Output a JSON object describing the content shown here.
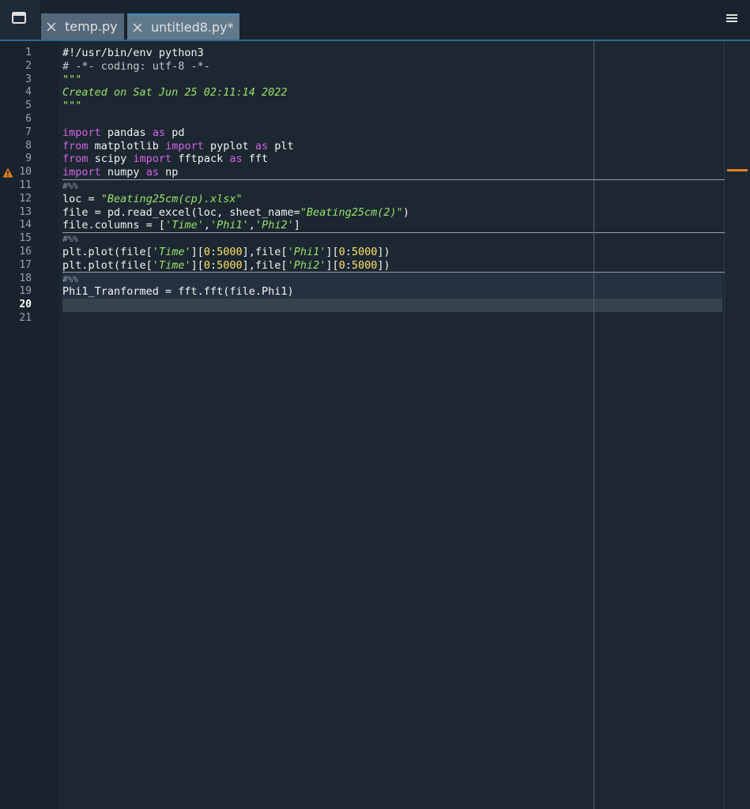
{
  "tabs": [
    {
      "label": "temp.py"
    },
    {
      "label": "untitled8.py*"
    }
  ],
  "icons": {
    "browse": "window-icon",
    "close": "close-icon",
    "menu": "hamburger-menu-icon",
    "warning": "warning-icon"
  },
  "colors": {
    "keyword": "#d664e6",
    "string": "#9be26b",
    "number": "#ffe066",
    "warning": "#e67e22",
    "tab_accent": "#3f88c4"
  },
  "editor": {
    "current_line": 20,
    "warning_line": 10,
    "lines": [
      {
        "n": "1",
        "tokens": [
          [
            "t",
            "#!/usr/bin/env python3"
          ]
        ]
      },
      {
        "n": "2",
        "tokens": [
          [
            "c",
            "# -*- coding: utf-8 -*-"
          ]
        ]
      },
      {
        "n": "3",
        "tokens": [
          [
            "d",
            "\"\"\""
          ]
        ]
      },
      {
        "n": "4",
        "tokens": [
          [
            "d",
            "Created on Sat Jun 25 02:11:14 2022"
          ]
        ]
      },
      {
        "n": "5",
        "tokens": [
          [
            "d",
            "\"\"\""
          ]
        ]
      },
      {
        "n": "6",
        "tokens": []
      },
      {
        "n": "7",
        "tokens": [
          [
            "k",
            "import"
          ],
          [
            "t",
            " pandas "
          ],
          [
            "k",
            "as"
          ],
          [
            "t",
            " pd"
          ]
        ]
      },
      {
        "n": "8",
        "tokens": [
          [
            "k",
            "from"
          ],
          [
            "t",
            " matplotlib "
          ],
          [
            "k",
            "import"
          ],
          [
            "t",
            " pyplot "
          ],
          [
            "k",
            "as"
          ],
          [
            "t",
            " plt"
          ]
        ]
      },
      {
        "n": "9",
        "tokens": [
          [
            "k",
            "from"
          ],
          [
            "t",
            " scipy "
          ],
          [
            "k",
            "import"
          ],
          [
            "t",
            " fftpack "
          ],
          [
            "k",
            "as"
          ],
          [
            "t",
            " fft"
          ]
        ]
      },
      {
        "n": "10",
        "tokens": [
          [
            "k",
            "import"
          ],
          [
            "t",
            " numpy "
          ],
          [
            "k",
            "as"
          ],
          [
            "t",
            " np"
          ]
        ]
      },
      {
        "n": "11",
        "tokens": [
          [
            "cell",
            "#%%"
          ]
        ]
      },
      {
        "n": "12",
        "tokens": [
          [
            "t",
            "loc = "
          ],
          [
            "s",
            "\""
          ],
          [
            "si",
            "Beating25cm(cp).xlsx"
          ],
          [
            "s",
            "\""
          ]
        ]
      },
      {
        "n": "13",
        "tokens": [
          [
            "t",
            "file = pd.read_excel(loc, sheet_name="
          ],
          [
            "s",
            "\""
          ],
          [
            "si",
            "Beating25cm(2)"
          ],
          [
            "s",
            "\""
          ],
          [
            "t",
            ")"
          ]
        ]
      },
      {
        "n": "14",
        "tokens": [
          [
            "t",
            "file.columns = ["
          ],
          [
            "s",
            "'"
          ],
          [
            "si",
            "Time"
          ],
          [
            "s",
            "'"
          ],
          [
            "t",
            ","
          ],
          [
            "s",
            "'"
          ],
          [
            "si",
            "Phi1"
          ],
          [
            "s",
            "'"
          ],
          [
            "t",
            ","
          ],
          [
            "s",
            "'"
          ],
          [
            "si",
            "Phi2"
          ],
          [
            "s",
            "'"
          ],
          [
            "t",
            "]"
          ]
        ]
      },
      {
        "n": "15",
        "tokens": [
          [
            "cell",
            "#%%"
          ]
        ]
      },
      {
        "n": "16",
        "tokens": [
          [
            "t",
            "plt.plot(file["
          ],
          [
            "s",
            "'"
          ],
          [
            "si",
            "Time"
          ],
          [
            "s",
            "'"
          ],
          [
            "t",
            "]["
          ],
          [
            "nm",
            "0"
          ],
          [
            "t",
            ":"
          ],
          [
            "nm",
            "5000"
          ],
          [
            "t",
            "],file["
          ],
          [
            "s",
            "'"
          ],
          [
            "si",
            "Phi1"
          ],
          [
            "s",
            "'"
          ],
          [
            "t",
            "]["
          ],
          [
            "nm",
            "0"
          ],
          [
            "t",
            ":"
          ],
          [
            "nm",
            "5000"
          ],
          [
            "t",
            "])"
          ]
        ]
      },
      {
        "n": "17",
        "tokens": [
          [
            "t",
            "plt.plot(file["
          ],
          [
            "s",
            "'"
          ],
          [
            "si",
            "Time"
          ],
          [
            "s",
            "'"
          ],
          [
            "t",
            "]["
          ],
          [
            "nm",
            "0"
          ],
          [
            "t",
            ":"
          ],
          [
            "nm",
            "5000"
          ],
          [
            "t",
            "],file["
          ],
          [
            "s",
            "'"
          ],
          [
            "si",
            "Phi2"
          ],
          [
            "s",
            "'"
          ],
          [
            "t",
            "]["
          ],
          [
            "nm",
            "0"
          ],
          [
            "t",
            ":"
          ],
          [
            "nm",
            "5000"
          ],
          [
            "t",
            "])"
          ]
        ]
      },
      {
        "n": "18",
        "tokens": [
          [
            "cell",
            "#%%"
          ]
        ]
      },
      {
        "n": "19",
        "tokens": [
          [
            "t",
            "Phi1_Tranformed = fft.fft(file.Phi1)"
          ]
        ]
      },
      {
        "n": "20",
        "tokens": []
      },
      {
        "n": "21",
        "tokens": []
      }
    ]
  }
}
